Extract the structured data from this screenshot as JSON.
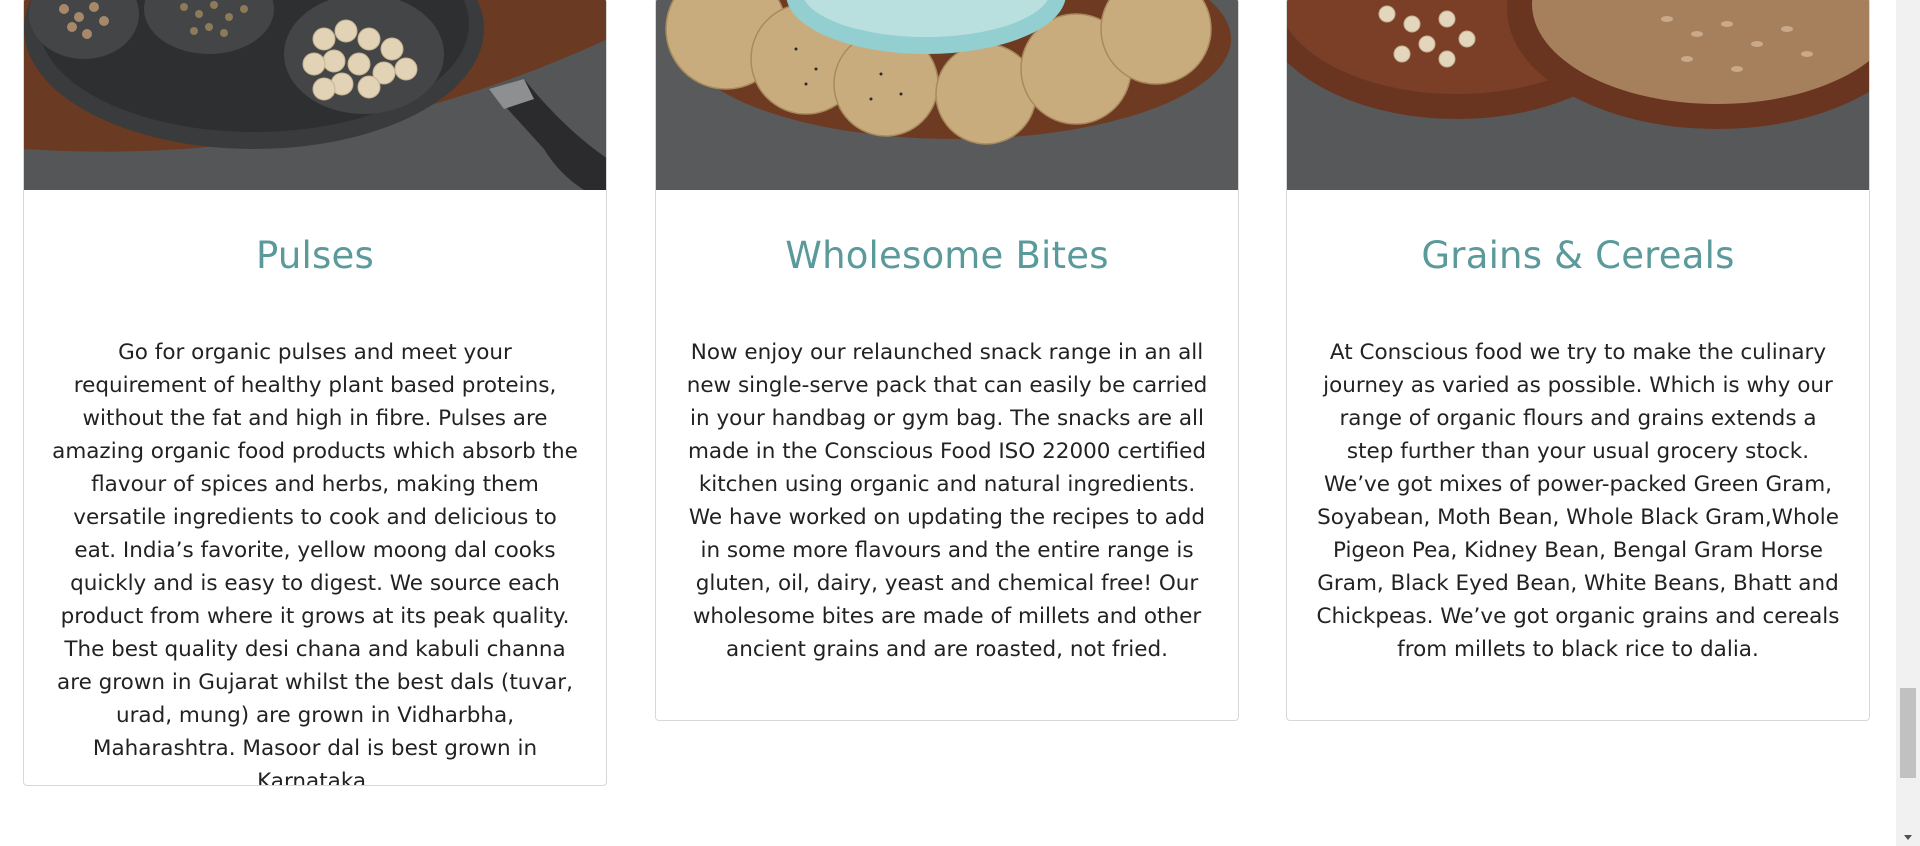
{
  "cards": [
    {
      "title": "Pulses",
      "text": "Go for organic pulses and meet your requirement of healthy plant based proteins, without the fat and high in fibre. Pulses are amazing organic food products which absorb the flavour of spices and herbs, making them versatile ingredients to cook and delicious to eat. India’s favorite, yellow moong dal cooks quickly and is easy to digest. We source each product from where it grows at its peak quality. The best quality desi chana and kabuli channa are grown in Gujarat whilst the best dals (tuvar, urad, mung) are grown in Vidharbha, Maharashtra. Masoor dal is best grown in Karnataka."
    },
    {
      "title": "Wholesome Bites",
      "text": "Now enjoy our relaunched snack range in an all new single-serve pack that can easily be carried in your handbag or gym bag. The snacks are all made in the Conscious Food ISO 22000 certified kitchen using organic and natural ingredients. We have worked on updating the recipes to add in some more flavours and the entire range is gluten, oil, dairy, yeast and chemical free! Our wholesome bites are made of millets and other ancient grains and are roasted, not fried."
    },
    {
      "title": "Grains & Cereals",
      "text": "At Conscious food we try to make the culinary journey as varied as possible. Which is why our range of organic flours and grains extends a step further than your usual grocery stock. We’ve got mixes of power-packed Green Gram, Soyabean, Moth Bean, Whole Black Gram,Whole Pigeon Pea, Kidney Bean, Bengal Gram Horse Gram, Black Eyed Bean, White Beans, Bhatt and Chickpeas. We’ve got organic grains and cereals from millets to black rice to dalia."
    }
  ],
  "colors": {
    "title": "#5b9a9b",
    "body_text": "#222222",
    "card_border": "#d8d8d8"
  }
}
